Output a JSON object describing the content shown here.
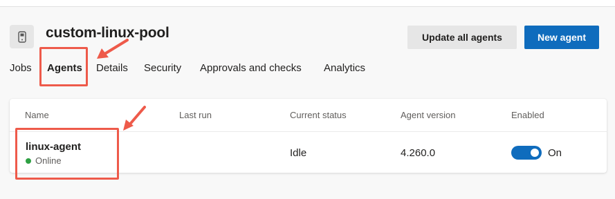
{
  "pool": {
    "title": "custom-linux-pool",
    "icon": "agent-pool-icon"
  },
  "actions": {
    "update_label": "Update all agents",
    "new_label": "New agent"
  },
  "tabs": [
    {
      "label": "Jobs"
    },
    {
      "label": "Agents",
      "active": true
    },
    {
      "label": "Details"
    },
    {
      "label": "Security"
    },
    {
      "label": "Approvals and checks"
    },
    {
      "label": "Analytics"
    }
  ],
  "table": {
    "columns": [
      "Name",
      "Last run",
      "Current status",
      "Agent version",
      "Enabled"
    ],
    "rows": [
      {
        "name": "linux-agent",
        "connection": "Online",
        "last_run": "",
        "status": "Idle",
        "version": "4.260.0",
        "enabled": true,
        "enabled_label": "On"
      }
    ]
  },
  "colors": {
    "accent": "#0f6cbd",
    "online": "#2ea043",
    "annotation": "#ee5a4a"
  }
}
